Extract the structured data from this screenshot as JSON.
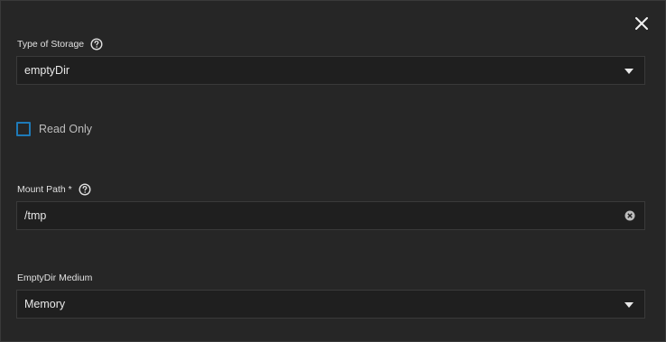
{
  "dialog": {
    "close_icon": "close-icon"
  },
  "storage_type": {
    "label": "Type of Storage",
    "help_icon": "help-circle-icon",
    "value": "emptyDir",
    "caret_icon": "caret-down-icon"
  },
  "read_only": {
    "label": "Read Only",
    "checked": false,
    "accent_color": "#1e7ab8"
  },
  "mount_path": {
    "label": "Mount Path *",
    "help_icon": "help-circle-icon",
    "value": "/tmp",
    "clear_icon": "clear-circle-icon"
  },
  "emptydir_medium": {
    "label": "EmptyDir Medium",
    "value": "Memory",
    "caret_icon": "caret-down-icon"
  }
}
